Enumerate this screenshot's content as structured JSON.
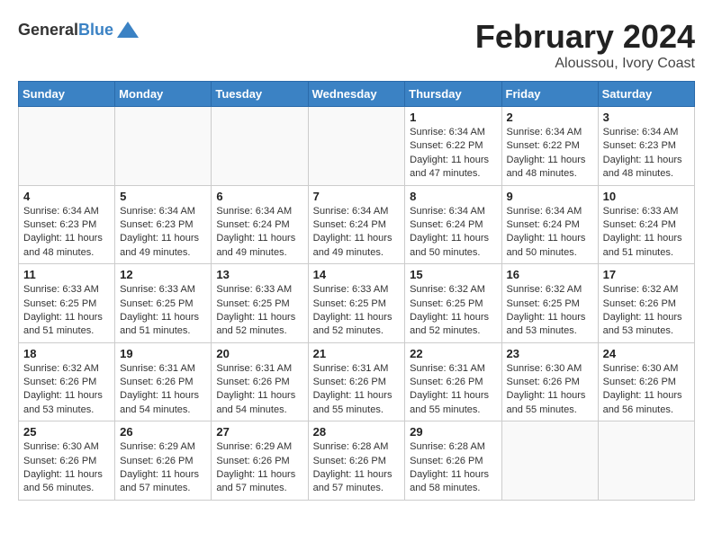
{
  "logo": {
    "general": "General",
    "blue": "Blue"
  },
  "title": {
    "month_year": "February 2024",
    "location": "Aloussou, Ivory Coast"
  },
  "weekdays": [
    "Sunday",
    "Monday",
    "Tuesday",
    "Wednesday",
    "Thursday",
    "Friday",
    "Saturday"
  ],
  "weeks": [
    [
      {
        "day": "",
        "info": ""
      },
      {
        "day": "",
        "info": ""
      },
      {
        "day": "",
        "info": ""
      },
      {
        "day": "",
        "info": ""
      },
      {
        "day": "1",
        "info": "Sunrise: 6:34 AM\nSunset: 6:22 PM\nDaylight: 11 hours and 47 minutes."
      },
      {
        "day": "2",
        "info": "Sunrise: 6:34 AM\nSunset: 6:22 PM\nDaylight: 11 hours and 48 minutes."
      },
      {
        "day": "3",
        "info": "Sunrise: 6:34 AM\nSunset: 6:23 PM\nDaylight: 11 hours and 48 minutes."
      }
    ],
    [
      {
        "day": "4",
        "info": "Sunrise: 6:34 AM\nSunset: 6:23 PM\nDaylight: 11 hours and 48 minutes."
      },
      {
        "day": "5",
        "info": "Sunrise: 6:34 AM\nSunset: 6:23 PM\nDaylight: 11 hours and 49 minutes."
      },
      {
        "day": "6",
        "info": "Sunrise: 6:34 AM\nSunset: 6:24 PM\nDaylight: 11 hours and 49 minutes."
      },
      {
        "day": "7",
        "info": "Sunrise: 6:34 AM\nSunset: 6:24 PM\nDaylight: 11 hours and 49 minutes."
      },
      {
        "day": "8",
        "info": "Sunrise: 6:34 AM\nSunset: 6:24 PM\nDaylight: 11 hours and 50 minutes."
      },
      {
        "day": "9",
        "info": "Sunrise: 6:34 AM\nSunset: 6:24 PM\nDaylight: 11 hours and 50 minutes."
      },
      {
        "day": "10",
        "info": "Sunrise: 6:33 AM\nSunset: 6:24 PM\nDaylight: 11 hours and 51 minutes."
      }
    ],
    [
      {
        "day": "11",
        "info": "Sunrise: 6:33 AM\nSunset: 6:25 PM\nDaylight: 11 hours and 51 minutes."
      },
      {
        "day": "12",
        "info": "Sunrise: 6:33 AM\nSunset: 6:25 PM\nDaylight: 11 hours and 51 minutes."
      },
      {
        "day": "13",
        "info": "Sunrise: 6:33 AM\nSunset: 6:25 PM\nDaylight: 11 hours and 52 minutes."
      },
      {
        "day": "14",
        "info": "Sunrise: 6:33 AM\nSunset: 6:25 PM\nDaylight: 11 hours and 52 minutes."
      },
      {
        "day": "15",
        "info": "Sunrise: 6:32 AM\nSunset: 6:25 PM\nDaylight: 11 hours and 52 minutes."
      },
      {
        "day": "16",
        "info": "Sunrise: 6:32 AM\nSunset: 6:25 PM\nDaylight: 11 hours and 53 minutes."
      },
      {
        "day": "17",
        "info": "Sunrise: 6:32 AM\nSunset: 6:26 PM\nDaylight: 11 hours and 53 minutes."
      }
    ],
    [
      {
        "day": "18",
        "info": "Sunrise: 6:32 AM\nSunset: 6:26 PM\nDaylight: 11 hours and 53 minutes."
      },
      {
        "day": "19",
        "info": "Sunrise: 6:31 AM\nSunset: 6:26 PM\nDaylight: 11 hours and 54 minutes."
      },
      {
        "day": "20",
        "info": "Sunrise: 6:31 AM\nSunset: 6:26 PM\nDaylight: 11 hours and 54 minutes."
      },
      {
        "day": "21",
        "info": "Sunrise: 6:31 AM\nSunset: 6:26 PM\nDaylight: 11 hours and 55 minutes."
      },
      {
        "day": "22",
        "info": "Sunrise: 6:31 AM\nSunset: 6:26 PM\nDaylight: 11 hours and 55 minutes."
      },
      {
        "day": "23",
        "info": "Sunrise: 6:30 AM\nSunset: 6:26 PM\nDaylight: 11 hours and 55 minutes."
      },
      {
        "day": "24",
        "info": "Sunrise: 6:30 AM\nSunset: 6:26 PM\nDaylight: 11 hours and 56 minutes."
      }
    ],
    [
      {
        "day": "25",
        "info": "Sunrise: 6:30 AM\nSunset: 6:26 PM\nDaylight: 11 hours and 56 minutes."
      },
      {
        "day": "26",
        "info": "Sunrise: 6:29 AM\nSunset: 6:26 PM\nDaylight: 11 hours and 57 minutes."
      },
      {
        "day": "27",
        "info": "Sunrise: 6:29 AM\nSunset: 6:26 PM\nDaylight: 11 hours and 57 minutes."
      },
      {
        "day": "28",
        "info": "Sunrise: 6:28 AM\nSunset: 6:26 PM\nDaylight: 11 hours and 57 minutes."
      },
      {
        "day": "29",
        "info": "Sunrise: 6:28 AM\nSunset: 6:26 PM\nDaylight: 11 hours and 58 minutes."
      },
      {
        "day": "",
        "info": ""
      },
      {
        "day": "",
        "info": ""
      }
    ]
  ]
}
